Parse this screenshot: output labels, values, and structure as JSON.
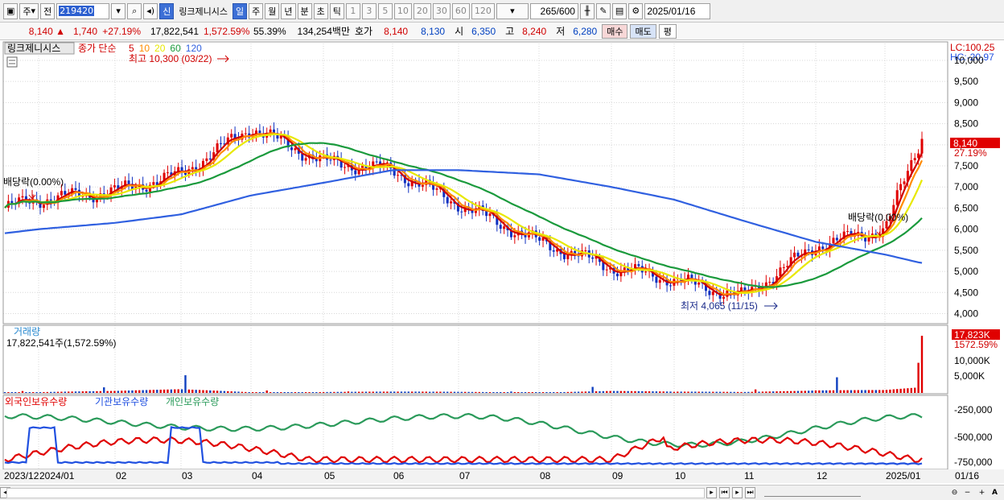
{
  "toolbar": {
    "period_label": "주",
    "prev_label": "전",
    "stock_code": "219420",
    "new_label": "신",
    "stock_name": "링크제니시스",
    "intervals": [
      "일",
      "주",
      "월",
      "년",
      "분",
      "초",
      "틱"
    ],
    "active_interval": "일",
    "ranges": [
      "1",
      "3",
      "5",
      "10",
      "20",
      "30",
      "60",
      "120"
    ],
    "count": "265",
    "count_max": "/600",
    "date": "2025/01/16"
  },
  "quote": {
    "price": "8,140",
    "arrow": "▲",
    "change": "1,740",
    "change_pct": "+27.19%",
    "volume": "17,822,541",
    "volume_pct": "1,572.59%",
    "turnover_ratio": "55.39%",
    "amount": "134,254백만",
    "bid_label": "호가",
    "ask_price": "8,140",
    "bid_price": "8,130",
    "open_label": "시",
    "open": "6,350",
    "high_label": "고",
    "high": "8,240",
    "low_label": "저",
    "low": "6,280",
    "buy_button": "매수",
    "sell_button": "매도",
    "eval_button": "평"
  },
  "price_panel": {
    "title": "링크제니시스",
    "legend_main": "종가 단순",
    "ma_labels": [
      "5",
      "10",
      "20",
      "60",
      "120"
    ],
    "ma_colors": [
      "#d00000",
      "#ff8c00",
      "#e8e800",
      "#1a9a3c",
      "#3060e0"
    ],
    "lc": "LC:100.25",
    "hc": "HC:-20.97",
    "high_annotation": "최고 10,300 (03/22)",
    "low_annotation": "최저 4,065 (11/15)",
    "dividend_left": "배당락(0.00%)",
    "dividend_right": "배당락(0.00%)",
    "last_price": "8,140",
    "last_pct": "27.19%",
    "y_ticks": [
      "10,000",
      "9,500",
      "9,000",
      "8,500",
      "8,000",
      "7,500",
      "7,000",
      "6,500",
      "6,000",
      "5,500",
      "5,000",
      "4,500",
      "4,000"
    ]
  },
  "volume_panel": {
    "title": "거래량",
    "summary": "17,822,541주(1,572.59%)",
    "last_value": "17,823K",
    "last_pct": "1572.59%",
    "y_ticks": [
      "10,000K",
      "5,000K"
    ]
  },
  "holder_panel": {
    "foreign_label": "외국인보유수량",
    "inst_label": "기관보유수량",
    "indiv_label": "개인보유수량",
    "colors": [
      "#e00000",
      "#2050e0",
      "#2a9a5a"
    ],
    "y_ticks": [
      "-250,000",
      "-500,000",
      "-750,000"
    ]
  },
  "x_axis": {
    "labels": [
      "2023/12",
      "2024/01",
      "02",
      "03",
      "04",
      "05",
      "06",
      "07",
      "08",
      "09",
      "10",
      "11",
      "12",
      "2025/01"
    ],
    "right_label": "01/16"
  },
  "chart_data": {
    "type": "line",
    "title": "링크제니시스",
    "x": [
      "2023/12",
      "2024/01",
      "02",
      "03",
      "04",
      "05",
      "06",
      "07",
      "08",
      "09",
      "10",
      "11",
      "12",
      "2025/01",
      "01/16"
    ],
    "series": [
      {
        "name": "종가",
        "values": [
          6500,
          6700,
          6900,
          7300,
          8400,
          7600,
          7400,
          6600,
          5700,
          5100,
          4800,
          4400,
          5600,
          6000,
          8140
        ]
      },
      {
        "name": "120",
        "values": [
          5900,
          6000,
          6150,
          6350,
          6800,
          7100,
          7400,
          7400,
          7300,
          7000,
          6700,
          6200,
          5700,
          5400,
          5200
        ]
      }
    ],
    "volume_k": [
      900,
      1200,
      3500,
      10600,
      1500,
      900,
      700,
      600,
      900,
      4300,
      600,
      500,
      9300,
      7900,
      17823
    ],
    "ylim": [
      3800,
      10400
    ]
  }
}
